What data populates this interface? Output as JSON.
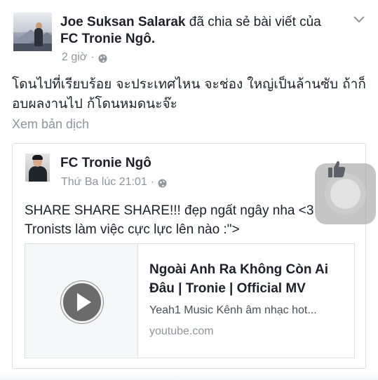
{
  "post": {
    "author": "Joe Suksan Salarak",
    "action": "đã chia sẻ bài viết của",
    "shared_from": "FC Tronie Ngô.",
    "time": "2 giờ",
    "separator": "·",
    "privacy_icon": "globe-icon",
    "text": "โดนไปที่เรียบร้อย จะประเทศไหน จะช่อง ใหญ่เป็นล้านซับ ถ้าก็อบผลงานไป ก้โดนหมดนะจ๊ะ",
    "see_translation": "Xem bản dịch"
  },
  "shared_post": {
    "author": "FC Tronie Ngô",
    "time": "Thứ Ba lúc 21:01",
    "separator": "·",
    "privacy_icon": "globe-icon",
    "text": "SHARE SHARE SHARE!!! đẹp ngất ngây nha <3 Tronists làm việc cực lực lên nào :\">"
  },
  "link_preview": {
    "title": "Ngoài Anh Ra Không Còn Ai Đâu | Tronie | Official MV",
    "description": "Yeah1 Music Kênh âm nhạc hot...",
    "domain": "youtube.com",
    "thumbnail_icon": "play-icon"
  },
  "icons": {
    "menu": "chevron-down-icon",
    "overlay": "assistive-touch-icon",
    "like": "thumbs-up-icon"
  },
  "colors": {
    "text": "#1d2129",
    "secondary": "#90949c",
    "border": "#dddfe2"
  }
}
